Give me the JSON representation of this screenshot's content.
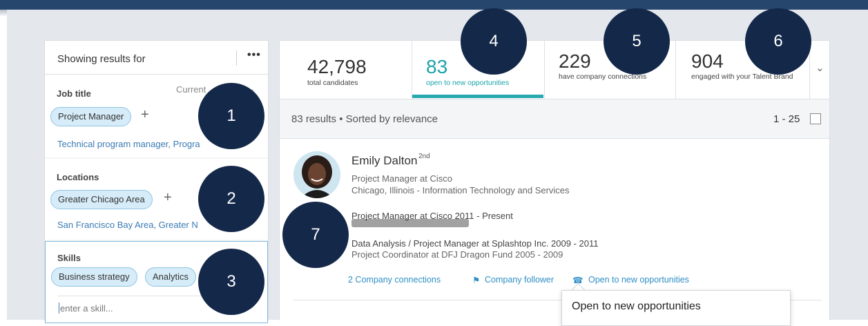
{
  "filters": {
    "header_label": "Showing results for",
    "more_label": "•••",
    "job_title": {
      "title": "Job title",
      "current_label": "Current",
      "chevron": "chevron-down-icon",
      "pill": "Project Manager",
      "add": "+",
      "suggestions": "Technical program manager, Progra"
    },
    "locations": {
      "title": "Locations",
      "pill": "Greater Chicago Area",
      "add": "+",
      "suggestions": "San Francisco Bay Area, Greater N"
    },
    "skills": {
      "title": "Skills",
      "pills": [
        "Business strategy",
        "Analytics"
      ],
      "placeholder": "enter a skill..."
    }
  },
  "stats": [
    {
      "number": "42,798",
      "caption": "total candidates",
      "active": false
    },
    {
      "number": "83",
      "caption": "open to new opportunities",
      "active": true
    },
    {
      "number": "229",
      "caption": "have company connections",
      "active": false
    },
    {
      "number": "904",
      "caption": "engaged with your Talent Brand",
      "active": false
    }
  ],
  "results": {
    "summary": "83 results • Sorted by relevance",
    "range": "1 - 25"
  },
  "candidate": {
    "name": "Emily Dalton",
    "degree": "2nd",
    "headline": "Project Manager at Cisco",
    "location": "Chicago, Illinois - Information Technology and Services",
    "experience": [
      "Project Manager at Cisco  2011 - Present",
      "Data Analysis / Project Manager at Splashtop Inc.  2009 - 2011",
      "Project Coordinator at DFJ Dragon Fund  2005 - 2009"
    ],
    "links": {
      "connections": "2 Company connections",
      "follower": "Company follower",
      "open": "Open to new opportunities"
    }
  },
  "tooltip": {
    "text": "Open to new opportunities"
  },
  "callouts": [
    "1",
    "2",
    "3",
    "4",
    "5",
    "6",
    "7"
  ],
  "colors": {
    "accent": "#1ba3a9",
    "link": "#2f8fc4",
    "callout": "#14284a",
    "topbar": "#27466e"
  }
}
